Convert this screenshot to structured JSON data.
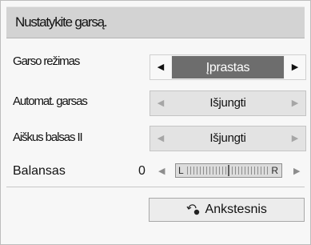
{
  "menu": {
    "title": "Nustatykite garsą.",
    "rows": [
      {
        "label": "Garso režimas",
        "value": "Įprastas"
      },
      {
        "label": "Automat. garsas",
        "value": "Išjungti"
      },
      {
        "label": "Aiškus balsas II",
        "value": "Išjungti"
      }
    ],
    "balance": {
      "label": "Balansas",
      "value": "0",
      "left_marker": "L",
      "right_marker": "R",
      "level": 0
    }
  },
  "footer": {
    "back_label": "Ankstesnis",
    "back_icon": "return-arrow-icon"
  },
  "icons": {
    "left_arrow": "◀",
    "right_arrow": "▶"
  },
  "colors": {
    "panel_background": "#f7f7f7",
    "title_bar": "#d3d3d3",
    "selected_value_background": "#6d6d6d",
    "selector_background": "#e3e3e3"
  }
}
